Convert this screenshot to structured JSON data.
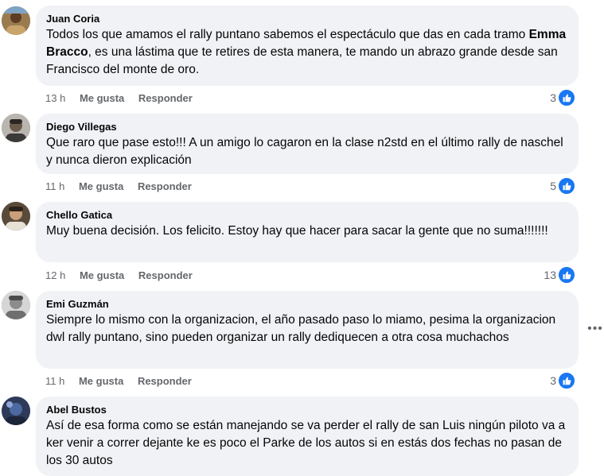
{
  "comments": [
    {
      "author": "Juan Coria",
      "text_before": "Todos los que amamos el rally puntano sabemos el espectáculo que das en cada tramo ",
      "mention": "Emma Bracco",
      "text_after": ", es una lástima que te retires de esta manera, te mando un abrazo grande desde san Francisco del monte de oro.",
      "time": "13 h",
      "like_label": "Me gusta",
      "reply_label": "Responder",
      "reaction_count": "3",
      "reaction_icon": "like-icon"
    },
    {
      "author": "Diego Villegas",
      "text": "Que raro que pase esto!!! A un amigo lo cagaron en la clase n2std en el último rally de naschel y nunca dieron explicación",
      "time": "11 h",
      "like_label": "Me gusta",
      "reply_label": "Responder",
      "reaction_count": "5",
      "reaction_icon": "like-icon"
    },
    {
      "author": "Chello Gatica",
      "text": "Muy buena decisión. Los felicito. Estoy hay que hacer para sacar la gente que no suma!!!!!!!",
      "time": "12 h",
      "like_label": "Me gusta",
      "reply_label": "Responder",
      "reaction_count": "13",
      "reaction_icon": "like-icon"
    },
    {
      "author": "Emi Guzmán",
      "text": "Siempre lo mismo con la organizacion, el año pasado paso lo miamo, pesima la organizacion dwl rally puntano, sino pueden organizar un rally dediquecen a otra cosa muchachos",
      "time": "11 h",
      "like_label": "Me gusta",
      "reply_label": "Responder",
      "reaction_count": "3",
      "reaction_icon": "like-icon"
    },
    {
      "author": "Abel Bustos",
      "text": "Así de esa forma como se están manejando se va perder el rally de san Luis ningún piloto va a ker venir a correr dejante ke es poco el Parke de los autos si en estás dos fechas no pasan de los 30 autos"
    }
  ],
  "more_options_icon": "more-horizontal-icon",
  "colors": {
    "bubble": "#f0f2f5",
    "meta_text": "#65676b",
    "like_blue": "#1877f2"
  }
}
